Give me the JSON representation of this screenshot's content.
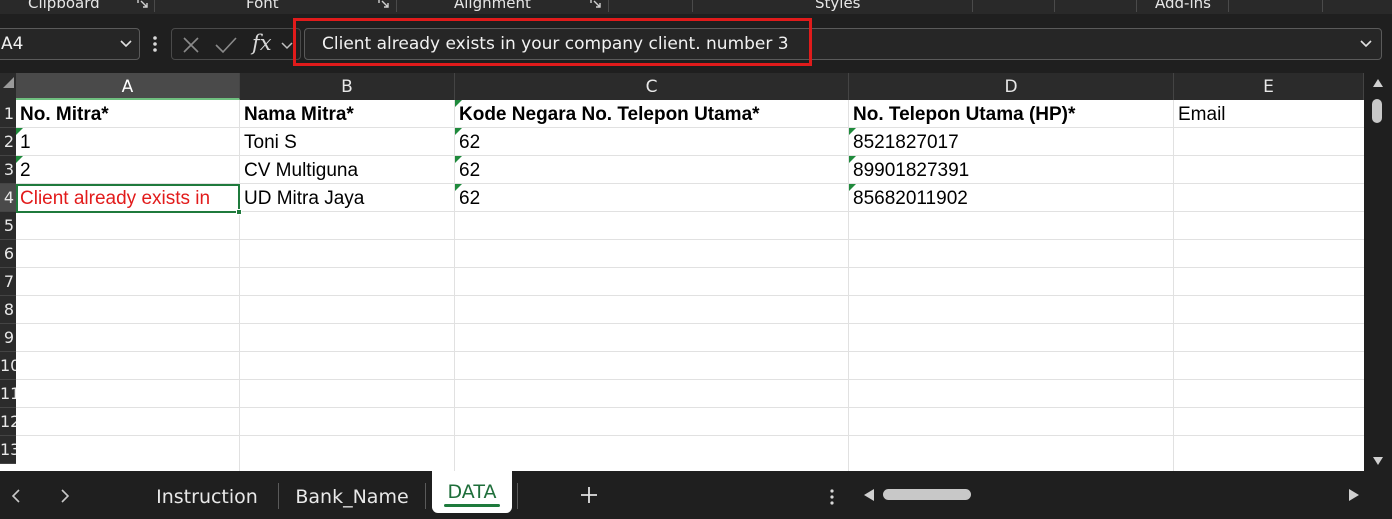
{
  "ribbon": {
    "groups": [
      "Clipboard",
      "Font",
      "Alignment",
      "Styles",
      "Add-ins"
    ]
  },
  "formula_bar": {
    "name_box": "A4",
    "fx_label": "fx",
    "formula_value": "Client already exists in your company client. number 3"
  },
  "grid": {
    "columns": [
      "A",
      "B",
      "C",
      "D",
      "E"
    ],
    "rows": [
      "1",
      "2",
      "3",
      "4",
      "5",
      "6",
      "7",
      "8",
      "9",
      "10",
      "11",
      "12",
      "13"
    ],
    "header_row": [
      "No. Mitra*",
      "Nama Mitra*",
      "Kode Negara No. Telepon Utama*",
      "No. Telepon Utama (HP)*",
      "Email"
    ],
    "data": [
      [
        "1",
        "Toni S",
        "62",
        "8521827017",
        ""
      ],
      [
        "2",
        "CV Multiguna",
        "62",
        "89901827391",
        ""
      ],
      [
        "Client already exists in",
        "UD Mitra Jaya",
        "62",
        "85682011902",
        ""
      ]
    ],
    "selected_cell": "A4"
  },
  "sheet_tabs": {
    "tabs": [
      "Instruction",
      "Bank_Name",
      "DATA"
    ],
    "active": "DATA",
    "add_label": "+"
  },
  "colors": {
    "error_text": "#e21b1b",
    "highlight_box": "#e01b1b",
    "selection": "#1f7a3c",
    "active_tab_text": "#1e6e3a"
  }
}
